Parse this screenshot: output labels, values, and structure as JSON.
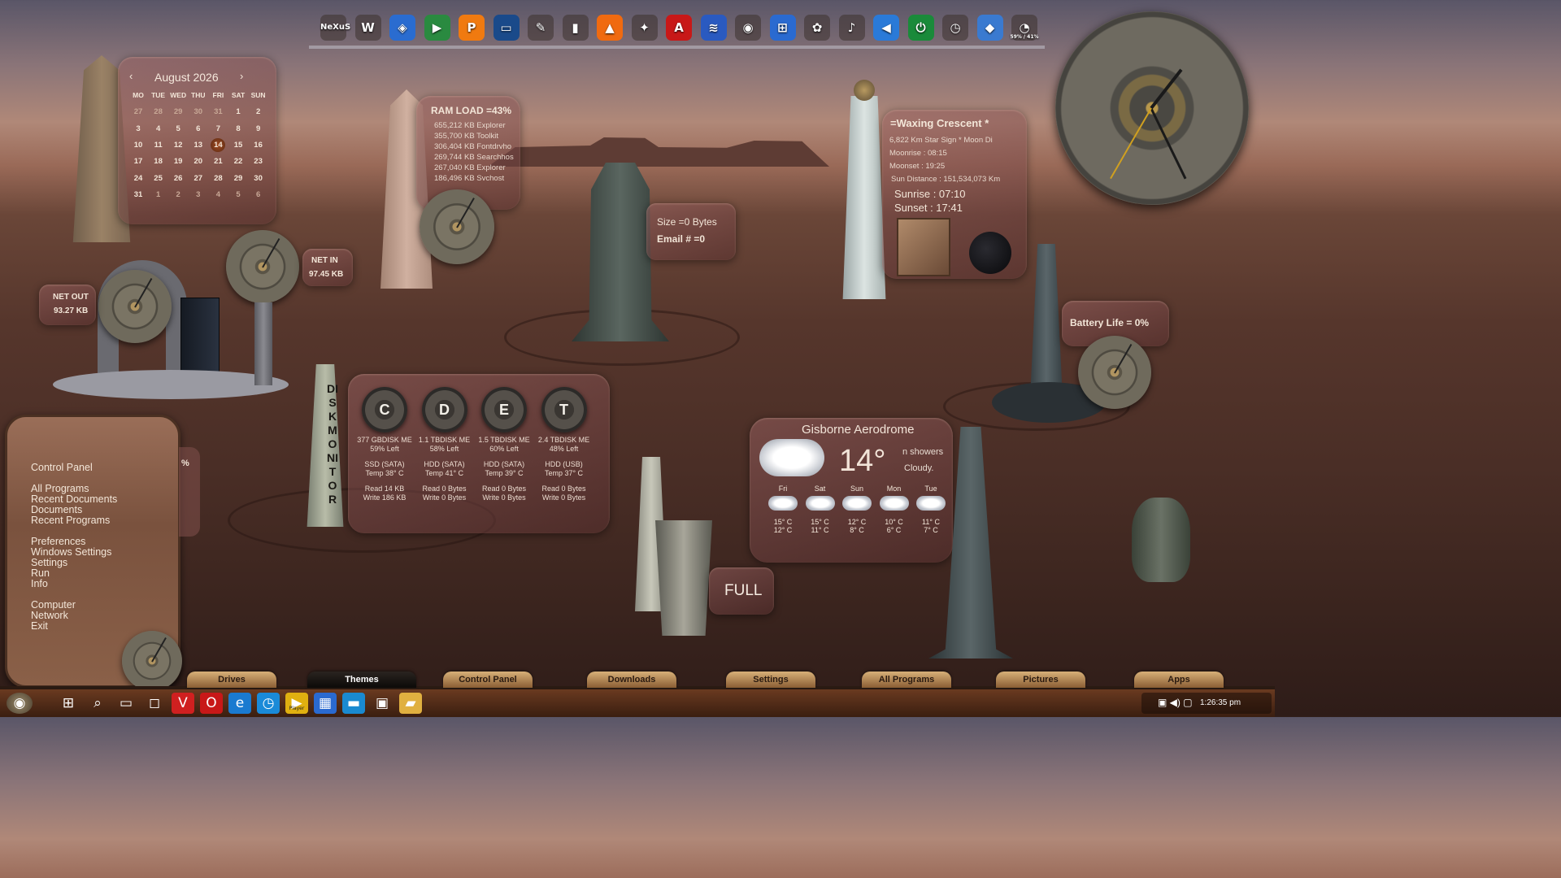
{
  "dock": {
    "icons": [
      "nexus-icon",
      "winamp-icon",
      "kodi-icon",
      "media-icon",
      "player-icon",
      "monitor-icon",
      "gimp-icon",
      "book-icon",
      "vlc-icon",
      "network-icon",
      "acrobat-icon",
      "wave-icon",
      "camera-icon",
      "windows-icon",
      "paint-icon",
      "music-icon",
      "volume-icon",
      "power-icon",
      "alarm-icon",
      "colors-icon",
      "cpu-meter-icon"
    ],
    "nexus": "NeXuS",
    "meter": "59% / 41%"
  },
  "calendar": {
    "month": "August 2026",
    "headers": [
      "MO",
      "TUE",
      "WED",
      "THU",
      "FRI",
      "SAT",
      "SUN"
    ],
    "weeks": [
      [
        "27",
        "28",
        "29",
        "30",
        "31",
        "1",
        "2"
      ],
      [
        "3",
        "4",
        "5",
        "6",
        "7",
        "8",
        "9"
      ],
      [
        "10",
        "11",
        "12",
        "13",
        "14",
        "15",
        "16"
      ],
      [
        "17",
        "18",
        "19",
        "20",
        "21",
        "22",
        "23"
      ],
      [
        "24",
        "25",
        "26",
        "27",
        "28",
        "29",
        "30"
      ],
      [
        "31",
        "1",
        "2",
        "3",
        "4",
        "5",
        "6"
      ]
    ],
    "today": "14"
  },
  "ram": {
    "title": "RAM LOAD =43%",
    "procs": [
      "655,212 KB Explorer",
      "355,700 KB Toolkit",
      "306,404 KB Fontdrvho",
      "269,744 KB Searchhos",
      "267,040 KB Explorer",
      "186,496 KB Svchost"
    ]
  },
  "net": {
    "in_label": "NET IN",
    "in_value": "97.45 KB",
    "out_label": "NET OUT",
    "out_value": "93.27 KB"
  },
  "mail": {
    "size": "Size =0 Bytes",
    "email": "Email # =0"
  },
  "moon": {
    "phase": "=Waxing Crescent *",
    "line1": "6,822 Km Star Sign * Moon Di",
    "moonrise": "Moonrise : 08:15",
    "moonset": "Moonset : 19:25",
    "sun_dist": "Sun Distance : 151,534,073 Km",
    "sunrise": "Sunrise : 07:10",
    "sunset": "Sunset : 17:41"
  },
  "battery": {
    "label": "Battery Life = 0%"
  },
  "disk": {
    "title": "DISKMONITOR",
    "drives": [
      {
        "letter": "C",
        "cap": "377 GBDISK ME",
        "left": "59% Left",
        "type": "SSD (SATA)",
        "temp": "Temp 38° C",
        "read": "Read 14 KB",
        "write": "Write 186 KB"
      },
      {
        "letter": "D",
        "cap": "1.1 TBDISK ME",
        "left": "58% Left",
        "type": "HDD (SATA)",
        "temp": "Temp 41° C",
        "read": "Read 0 Bytes",
        "write": "Write 0 Bytes"
      },
      {
        "letter": "E",
        "cap": "1.5 TBDISK ME",
        "left": "60% Left",
        "type": "HDD (SATA)",
        "temp": "Temp 39° C",
        "read": "Read 0 Bytes",
        "write": "Write 0 Bytes"
      },
      {
        "letter": "T",
        "cap": "2.4 TBDISK ME",
        "left": "48% Left",
        "type": "HDD (USB)",
        "temp": "Temp 37° C",
        "read": "Read 0 Bytes",
        "write": "Write 0 Bytes"
      }
    ]
  },
  "menu": {
    "items": [
      "Control Panel",
      "All Programs",
      "Recent Documents",
      "Documents",
      "Recent Programs",
      "Preferences",
      "Windows Settings",
      "Settings",
      "Run",
      "Info",
      "Computer",
      "Network",
      "Exit"
    ],
    "pct": "%"
  },
  "weather": {
    "location": "Gisborne Aerodrome",
    "temp": "14°",
    "desc1": "n showers",
    "desc2": "Cloudy.",
    "days": [
      {
        "d": "Fri",
        "hi": "15° C",
        "lo": "12° C"
      },
      {
        "d": "Sat",
        "hi": "15° C",
        "lo": "11° C"
      },
      {
        "d": "Sun",
        "hi": "12° C",
        "lo": "8° C"
      },
      {
        "d": "Mon",
        "hi": "10° C",
        "lo": "6° C"
      },
      {
        "d": "Tue",
        "hi": "11° C",
        "lo": "7° C"
      }
    ]
  },
  "recycle": {
    "label": "FULL"
  },
  "tabs": [
    "Drives",
    "Themes",
    "Control Panel",
    "Downloads",
    "Settings",
    "All Programs",
    "Pictures",
    "Apps"
  ],
  "taskbar": {
    "icons": [
      "orb-icon",
      "windows-start-icon",
      "search-icon",
      "task-view-icon",
      "chat-icon",
      "vivaldi-icon",
      "opera-icon",
      "edge-icon",
      "timer-icon",
      "player-icon",
      "store-icon",
      "window-icon",
      "remote-desktop-icon",
      "folder-icon"
    ],
    "player_label": "Player",
    "clock": "1:26:35 pm"
  }
}
